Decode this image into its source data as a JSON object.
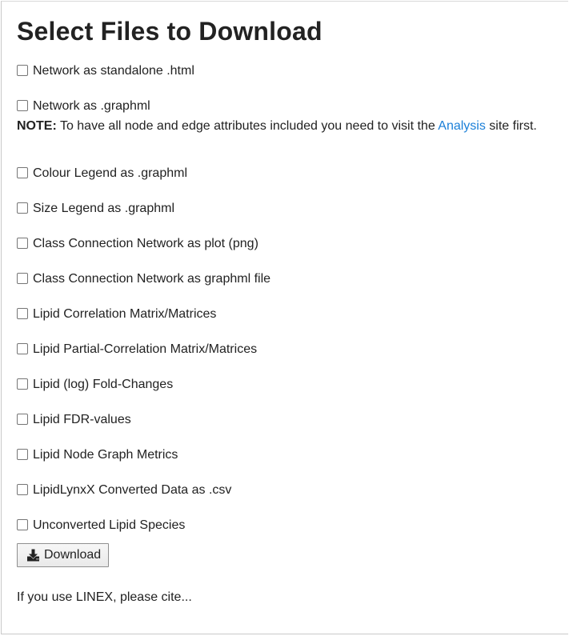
{
  "page": {
    "title": "Select Files to Download"
  },
  "options": [
    {
      "label": "Network as standalone .html",
      "checked": false
    },
    {
      "label": "Network as .graphml",
      "checked": false
    },
    {
      "label": "Colour Legend as .graphml",
      "checked": false
    },
    {
      "label": "Size Legend as .graphml",
      "checked": false
    },
    {
      "label": "Class Connection Network as plot (png)",
      "checked": false
    },
    {
      "label": "Class Connection Network as graphml file",
      "checked": false
    },
    {
      "label": "Lipid Correlation Matrix/Matrices",
      "checked": false
    },
    {
      "label": "Lipid Partial-Correlation Matrix/Matrices",
      "checked": false
    },
    {
      "label": "Lipid (log) Fold-Changes",
      "checked": false
    },
    {
      "label": "Lipid FDR-values",
      "checked": false
    },
    {
      "label": "Lipid Node Graph Metrics",
      "checked": false
    },
    {
      "label": "LipidLynxX Converted Data as .csv",
      "checked": false
    },
    {
      "label": "Unconverted Lipid Species",
      "checked": false
    }
  ],
  "note": {
    "bold": "NOTE:",
    "before_link": " To have all node and edge attributes included you need to visit the ",
    "link": "Analysis",
    "after_link": " site first."
  },
  "download_button": {
    "label": "Download",
    "icon": "download-icon"
  },
  "cite_text": "If you use LINEX, please cite..."
}
